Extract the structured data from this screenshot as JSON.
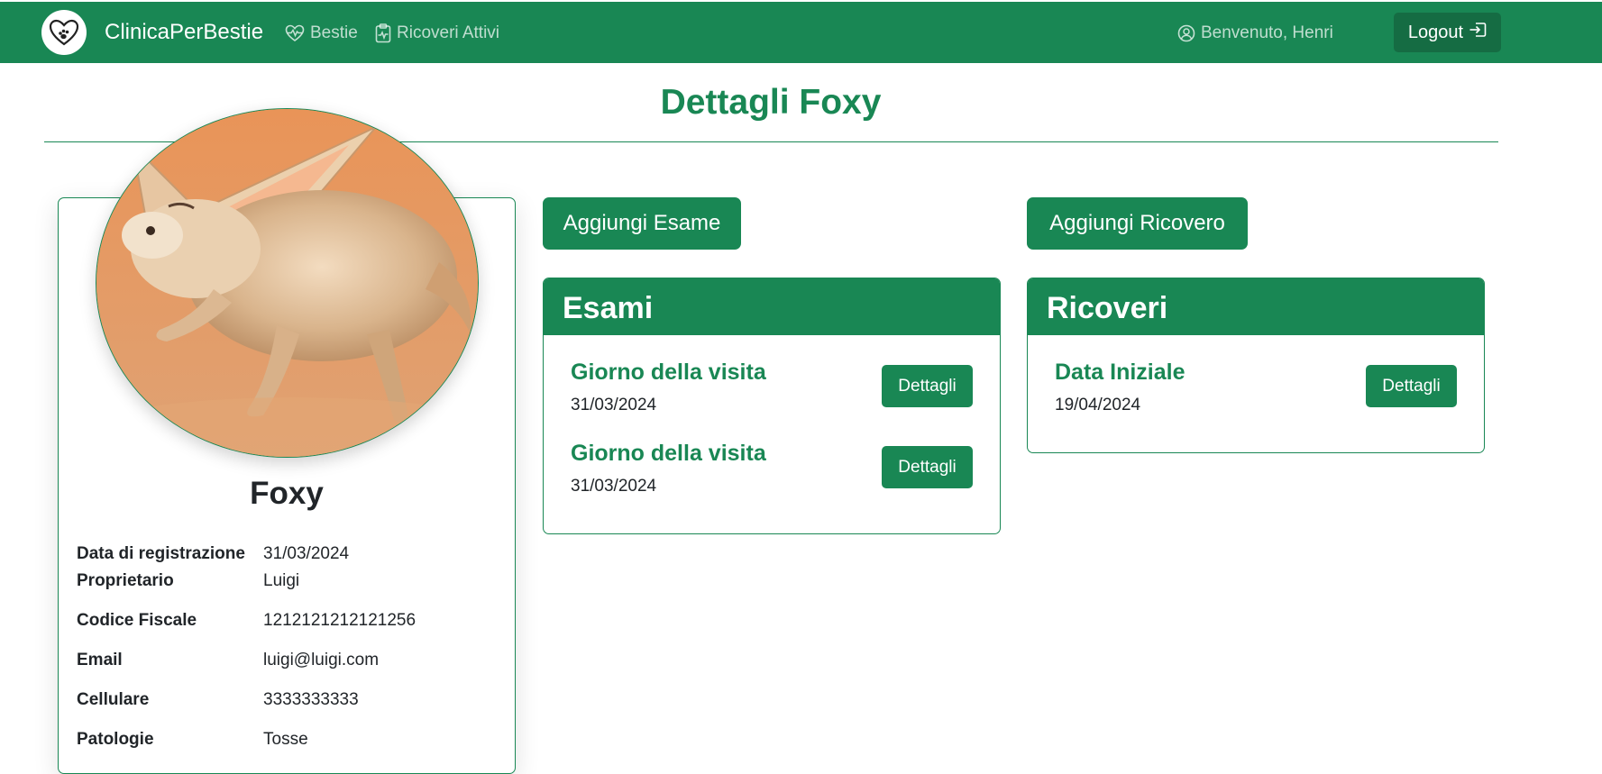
{
  "navbar": {
    "brand": "ClinicaPerBestie",
    "logo_icon": "paw-heart-icon",
    "links": [
      {
        "label": "Bestie",
        "icon": "heart-pulse-icon"
      },
      {
        "label": "Ricoveri Attivi",
        "icon": "clipboard-pulse-icon"
      }
    ],
    "welcome": "Benvenuto, Henri",
    "welcome_icon": "user-circle-icon",
    "logout_label": "Logout",
    "logout_icon": "box-arrow-in-right-icon"
  },
  "page": {
    "title": "Dettagli Foxy"
  },
  "pet": {
    "name": "Foxy",
    "photo_subject": "fennec fox",
    "info": [
      {
        "label": "Data di registrazione",
        "value": "31/03/2024"
      },
      {
        "label": "Proprietario",
        "value": "Luigi"
      },
      {
        "label": "Codice Fiscale",
        "value": "1212121212121256"
      },
      {
        "label": "Email",
        "value": "luigi@luigi.com"
      },
      {
        "label": "Cellulare",
        "value": "3333333333"
      },
      {
        "label": "Patologie",
        "value": "Tosse"
      }
    ]
  },
  "actions": {
    "add_exam": "Aggiungi Esame",
    "add_admission": "Aggiungi Ricovero"
  },
  "esami": {
    "title": "Esami",
    "items": [
      {
        "title": "Giorno della visita",
        "date": "31/03/2024",
        "button": "Dettagli"
      },
      {
        "title": "Giorno della visita",
        "date": "31/03/2024",
        "button": "Dettagli"
      }
    ]
  },
  "ricoveri": {
    "title": "Ricoveri",
    "items": [
      {
        "title": "Data Iniziale",
        "date": "19/04/2024",
        "button": "Dettagli"
      }
    ]
  },
  "colors": {
    "primary": "#198754",
    "primary_dark": "#156c43",
    "text": "#212529",
    "photo_background": "#e8925a"
  }
}
